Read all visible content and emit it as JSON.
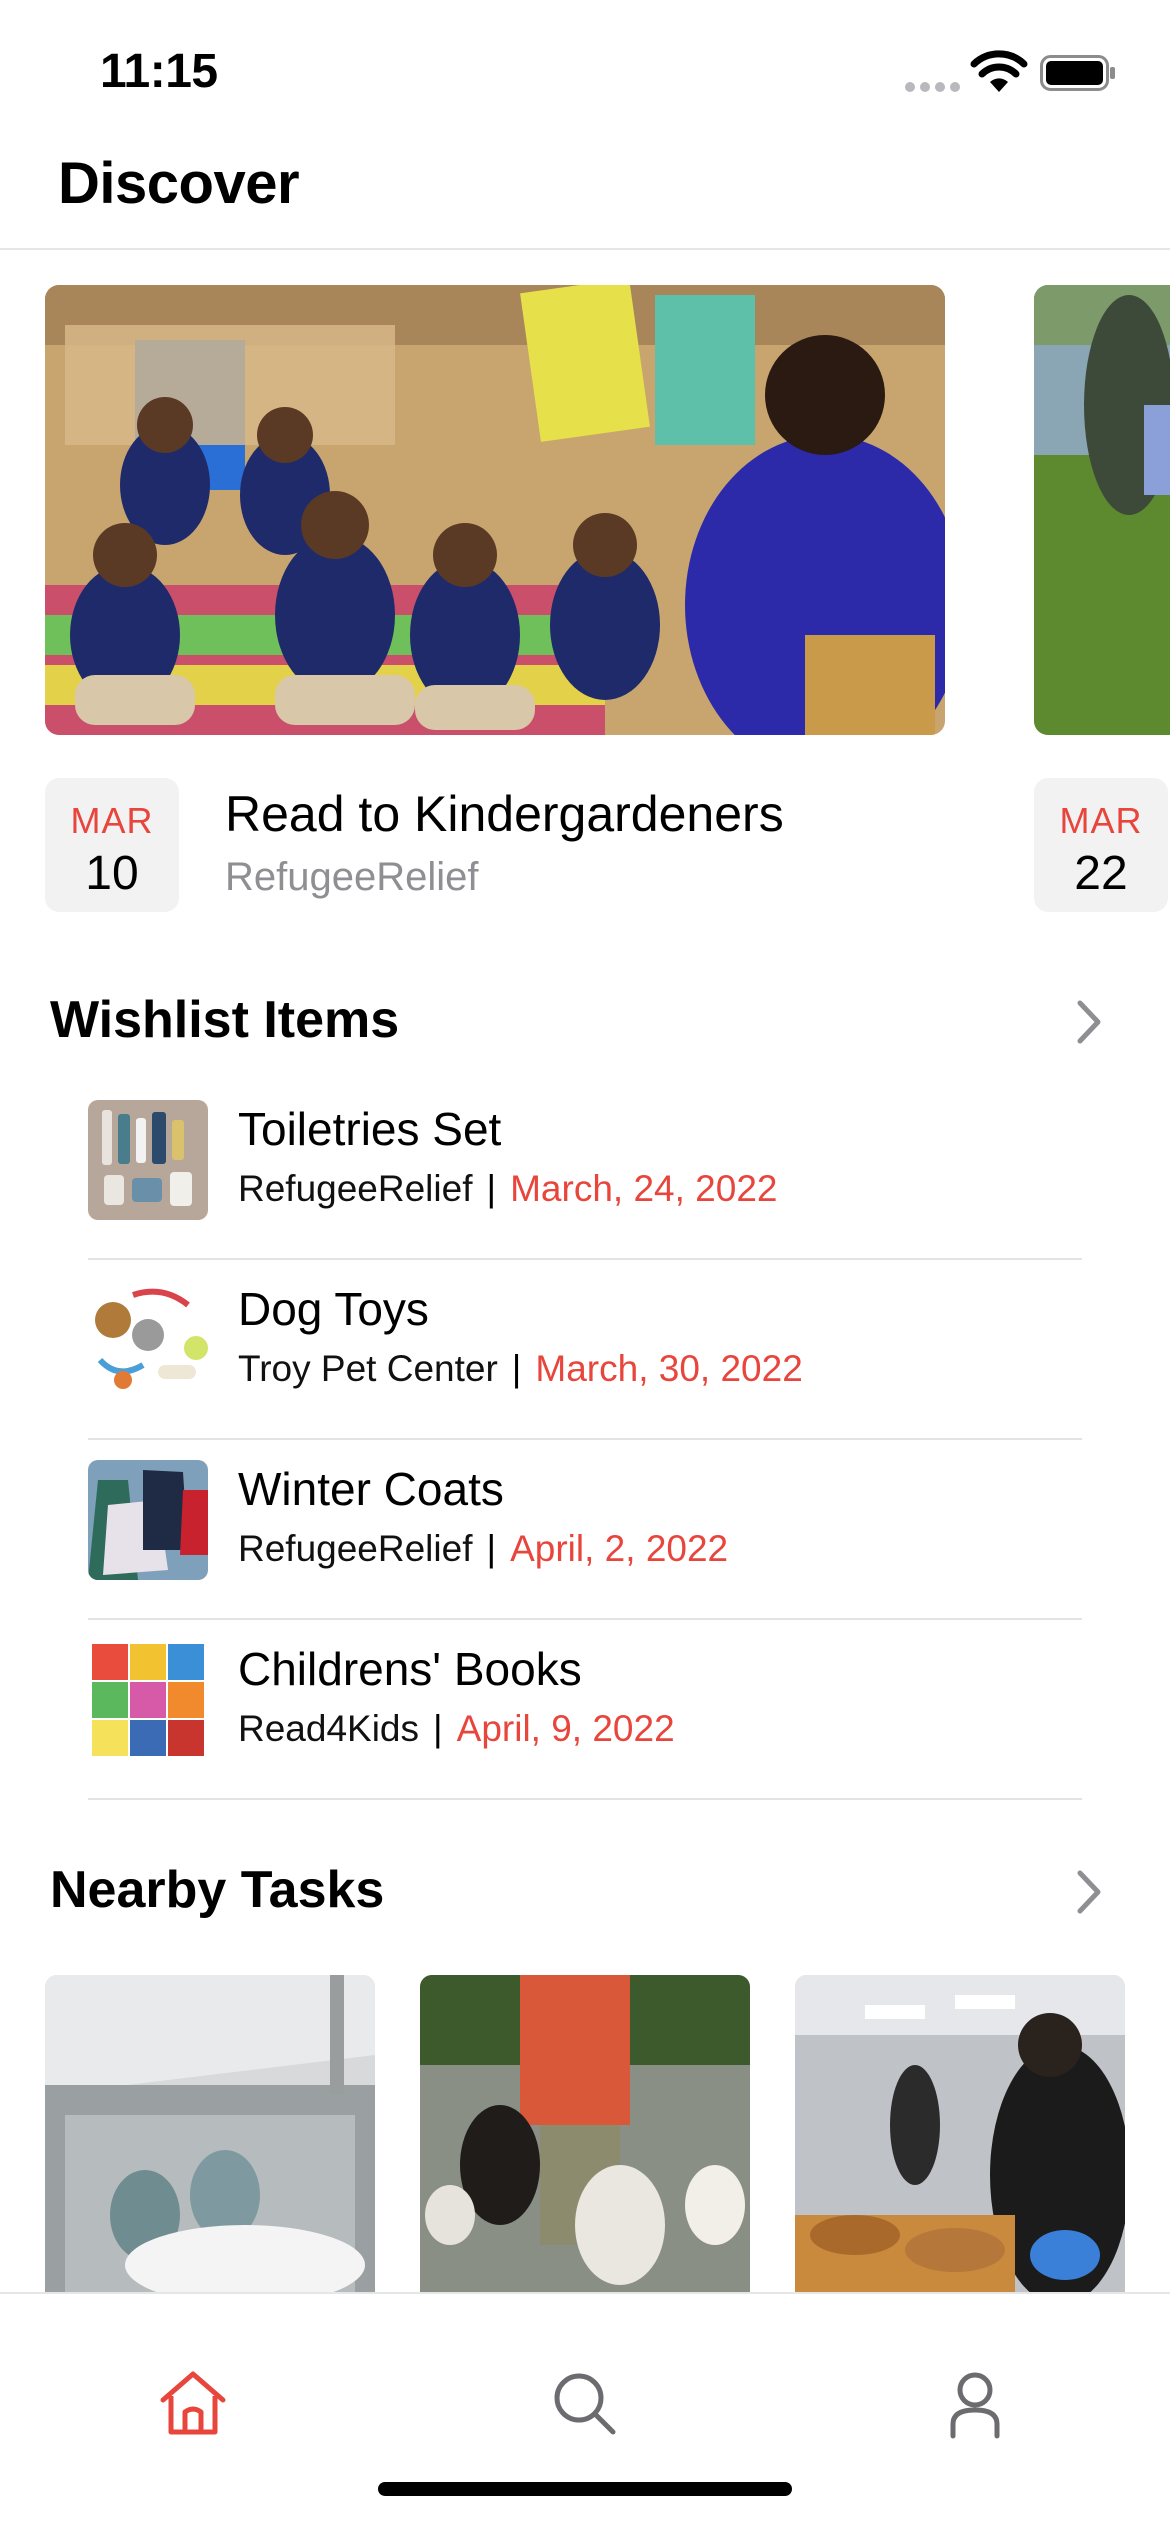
{
  "status_bar": {
    "time": "11:15"
  },
  "header": {
    "title": "Discover"
  },
  "featured_events": [
    {
      "title": "Read to Kindergardeners",
      "organization": "RefugeeRelief",
      "month": "MAR",
      "day": "10",
      "image": "classroom-reading-photo"
    },
    {
      "title": "",
      "organization": "",
      "month": "MAR",
      "day": "22",
      "image": "outdoor-cleanup-photo"
    }
  ],
  "wishlist": {
    "title": "Wishlist Items",
    "items": [
      {
        "name": "Toiletries Set",
        "organization": "RefugeeRelief",
        "separator": "|",
        "date": "March, 24, 2022",
        "thumbnail": "toiletries-photo"
      },
      {
        "name": "Dog Toys",
        "organization": "Troy Pet Center",
        "separator": "|",
        "date": "March, 30, 2022",
        "thumbnail": "dog-toys-photo"
      },
      {
        "name": "Winter Coats",
        "organization": "RefugeeRelief",
        "separator": "|",
        "date": "April, 2, 2022",
        "thumbnail": "winter-coats-photo"
      },
      {
        "name": "Childrens' Books",
        "organization": "Read4Kids",
        "separator": "|",
        "date": "April, 9, 2022",
        "thumbnail": "childrens-books-photo"
      }
    ]
  },
  "nearby_tasks": {
    "title": "Nearby Tasks",
    "tasks": [
      {
        "image": "dishwashing-sink-photo"
      },
      {
        "image": "dog-walking-photo"
      },
      {
        "image": "food-prep-kitchen-photo"
      }
    ]
  },
  "tab_bar": {
    "tabs": [
      {
        "icon": "home-icon",
        "active": true
      },
      {
        "icon": "search-icon",
        "active": false
      },
      {
        "icon": "profile-icon",
        "active": false
      }
    ]
  },
  "colors": {
    "accent": "#e8453c",
    "secondary_text": "#8e8e93",
    "divider": "#e3e3e3",
    "date_box_bg": "#f2f2f2"
  }
}
